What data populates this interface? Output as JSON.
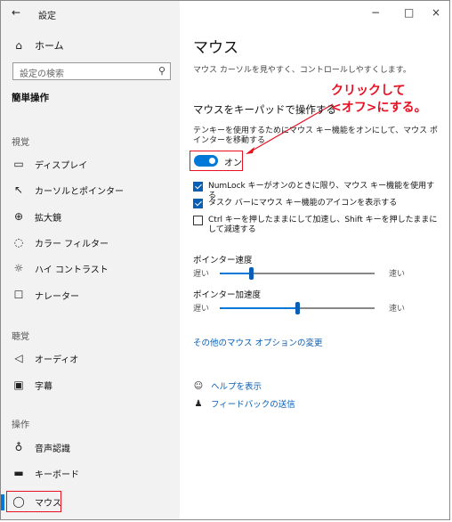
{
  "window": {
    "title": "設定",
    "back_icon": "←",
    "minimize": "−",
    "maximize": "□",
    "close": "×"
  },
  "sidebar": {
    "home": {
      "label": "ホーム",
      "icon": "⌂"
    },
    "search_placeholder": "設定の検索",
    "section_heading": "簡単操作",
    "groups": [
      {
        "label": "視覚",
        "items": [
          {
            "label": "ディスプレイ",
            "icon": "▭"
          },
          {
            "label": "カーソルとポインター",
            "icon": "↖"
          },
          {
            "label": "拡大鏡",
            "icon": "⊕"
          },
          {
            "label": "カラー フィルター",
            "icon": "◌"
          },
          {
            "label": "ハイ コントラスト",
            "icon": "☼"
          },
          {
            "label": "ナレーター",
            "icon": "☐"
          }
        ]
      },
      {
        "label": "聴覚",
        "items": [
          {
            "label": "オーディオ",
            "icon": "◁"
          },
          {
            "label": "字幕",
            "icon": "▣"
          }
        ]
      },
      {
        "label": "操作",
        "items": [
          {
            "label": "音声認識",
            "icon": "♁"
          },
          {
            "label": "キーボード",
            "icon": "▬"
          },
          {
            "label": "マウス",
            "icon": "◯",
            "selected": true
          }
        ]
      }
    ]
  },
  "main": {
    "title": "マウス",
    "description": "マウス カーソルを見やすく、コントロールしやすくします。",
    "section_title": "マウスをキーパッドで操作する",
    "annotation_line1": "クリックして",
    "annotation_line2": "<オフ>にする。",
    "toggle_desc": "テンキーを使用するためにマウス キー機能をオンにして、マウス ポインターを移動する",
    "toggle_state": "オン",
    "checkboxes": [
      {
        "label": "NumLock キーがオンのときに限り、マウス キー機能を使用する",
        "checked": true
      },
      {
        "label": "タスク バーにマウス キー機能のアイコンを表示する",
        "checked": true
      },
      {
        "label": "Ctrl キーを押したままにして加速し、Shift キーを押したままにして減速する",
        "checked": false
      }
    ],
    "speed": {
      "label": "ポインター速度",
      "slow": "遅い",
      "fast": "速い",
      "level": 0.2
    },
    "accel": {
      "label": "ポインター加速度",
      "slow": "遅い",
      "fast": "速い",
      "level": 0.5
    },
    "other_options_link": "その他のマウス オプションの変更",
    "help_link": "ヘルプを表示",
    "feedback_link": "フィードバックの送信"
  },
  "colors": {
    "accent": "#0078d7",
    "annotation": "#e81123",
    "sidebar_bg": "#f2f2f2"
  }
}
